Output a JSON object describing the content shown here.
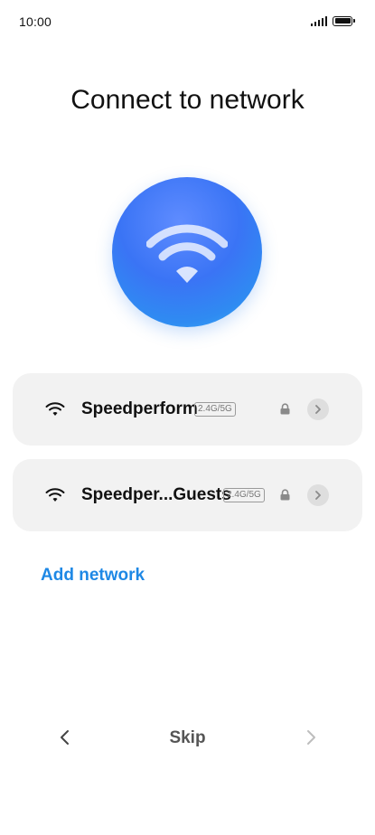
{
  "status_bar": {
    "time": "10:00"
  },
  "page": {
    "title": "Connect to network"
  },
  "networks": [
    {
      "name": "Speedperform",
      "band": "2.4G/5G",
      "secured": true
    },
    {
      "name": "Speedper...Guests",
      "band": "2.4G/5G",
      "secured": true
    }
  ],
  "actions": {
    "add_network": "Add network",
    "skip": "Skip"
  },
  "colors": {
    "accent": "#1e88e5",
    "card_background": "#f2f2f2",
    "hero_blue": "#3a74f5"
  },
  "icons": {
    "hero": "wifi-icon",
    "network": "wifi-icon",
    "secured": "lock-icon",
    "details": "chevron-right-icon",
    "back": "chevron-left-icon",
    "next": "chevron-right-icon"
  }
}
